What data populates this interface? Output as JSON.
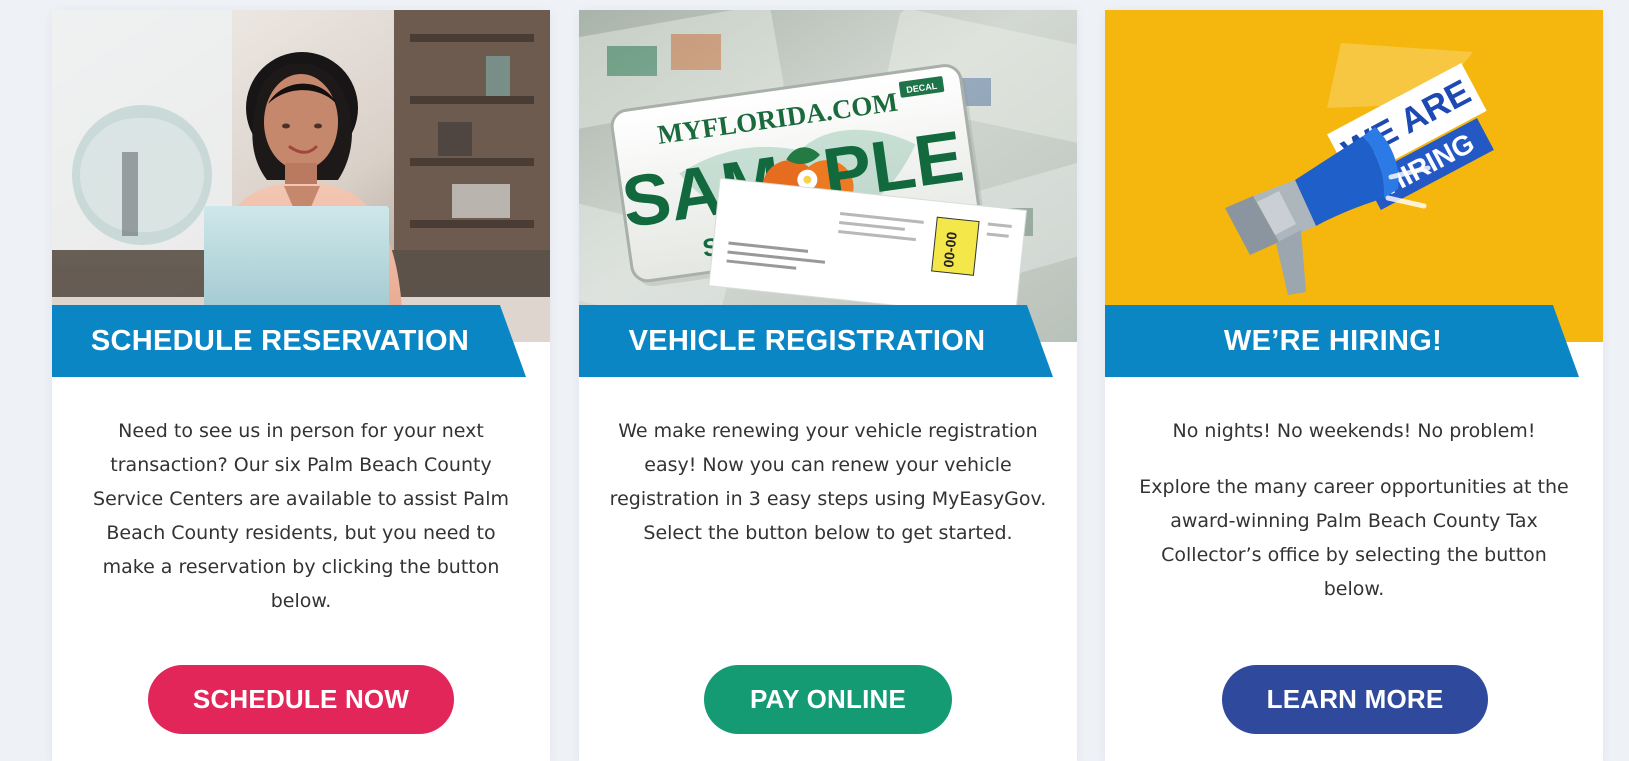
{
  "cards": [
    {
      "title": "SCHEDULE RESERVATION",
      "paragraphs": [
        "Need to see us in person for your next transaction? Our six Palm Beach County Service Centers are available to assist Palm Beach County residents, but you need to make a reservation by clicking the button below."
      ],
      "button": "SCHEDULE NOW"
    },
    {
      "title": "VEHICLE REGISTRATION",
      "paragraphs": [
        "We make renewing your vehicle registration easy! Now you can renew your vehicle registration in 3 easy steps using MyEasyGov. Select the button below to get started."
      ],
      "button": "PAY ONLINE",
      "image_text": {
        "site": "MYFLORIDA.COM",
        "decal": "DECAL",
        "word_left": "SAM",
        "word_right": "PLE",
        "state": "SUNSHINE STATE",
        "decal_tag": "00-00"
      }
    },
    {
      "title": "WE’RE HIRING!",
      "paragraphs": [
        "No nights! No weekends! No problem!",
        "Explore the many career opportunities at the award-winning Palm Beach County Tax Collector’s office by selecting the button below."
      ],
      "button": "LEARN MORE",
      "image_text": {
        "line1": "WE ARE",
        "line2": "HIRING"
      }
    }
  ],
  "colors": {
    "banner": "#0a86c5",
    "schedule_button": "#e2265a",
    "pay_button": "#149b73",
    "learn_button": "#2f4a9d",
    "hiring_background": "#f5b70d"
  },
  "icons": [
    "person-at-laptop-photo",
    "sample-license-plate-image",
    "megaphone-icon"
  ]
}
